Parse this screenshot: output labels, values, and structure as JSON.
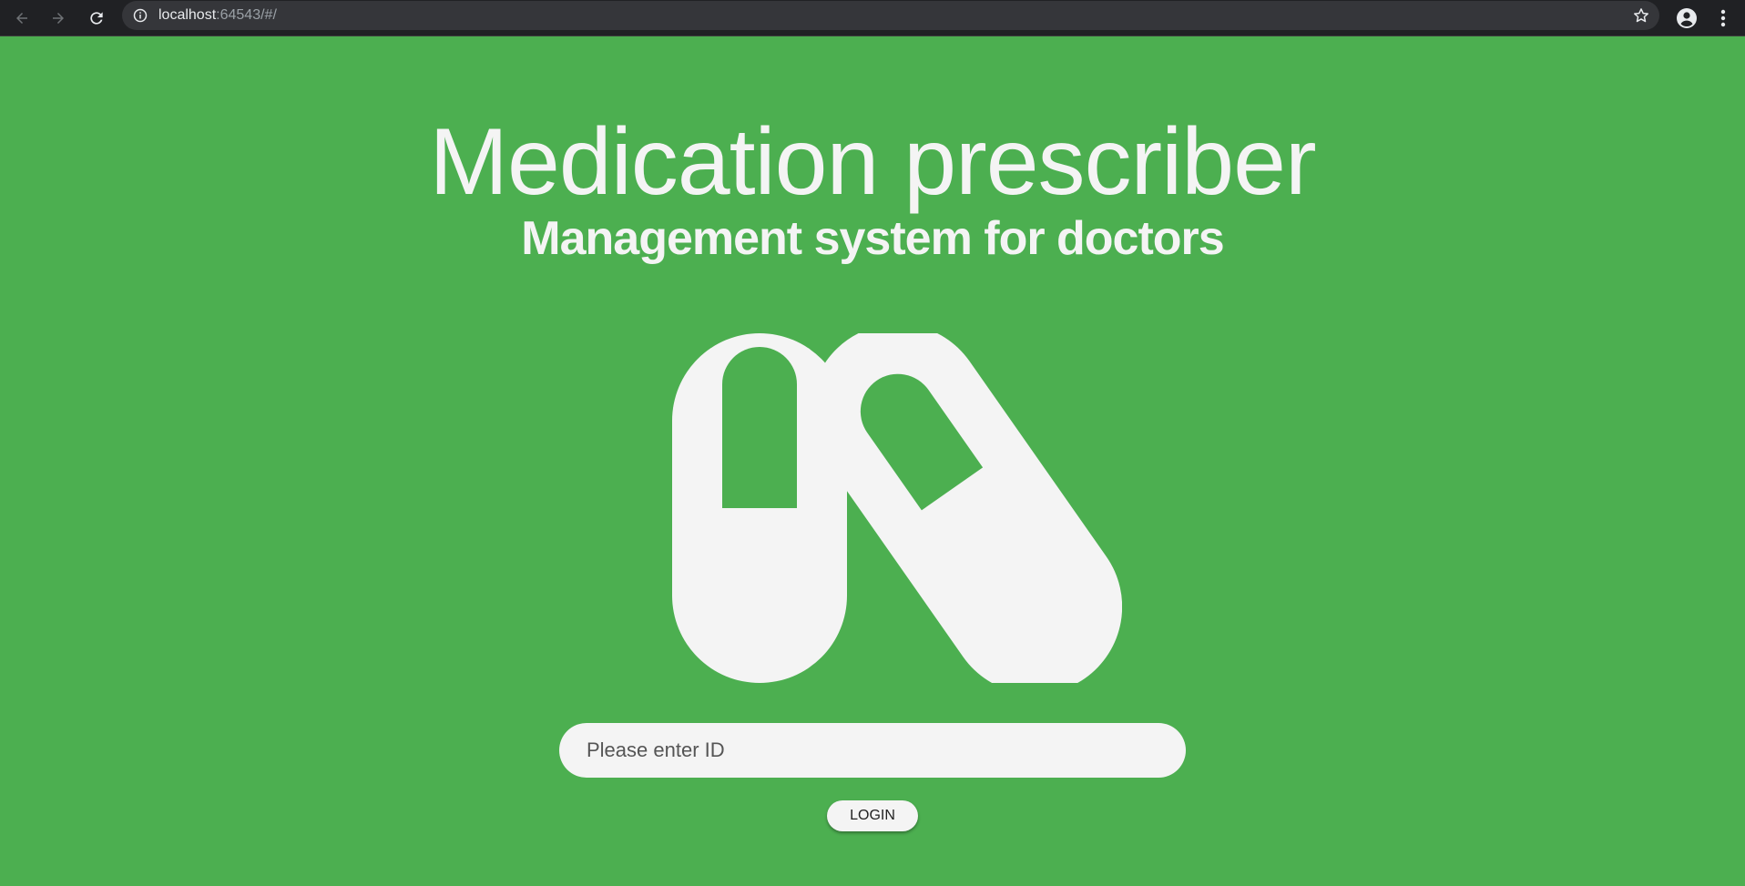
{
  "browser": {
    "url_host": "localhost",
    "url_rest": ":64543/#/",
    "icons": {
      "back": "arrow-left-icon",
      "forward": "arrow-right-icon",
      "reload": "reload-icon",
      "info": "info-icon",
      "bookmark": "star-icon",
      "profile": "account-circle-icon",
      "menu": "kebab-menu-icon"
    }
  },
  "page": {
    "title": "Medication prescriber",
    "subtitle": "Management system for doctors",
    "logo_icon": "pills-icon",
    "id_input": {
      "placeholder": "Please enter ID",
      "value": ""
    },
    "login_label": "LOGIN"
  },
  "colors": {
    "background": "#4caf50",
    "foreground": "#f4f4f4",
    "browser_chrome": "#202124"
  }
}
